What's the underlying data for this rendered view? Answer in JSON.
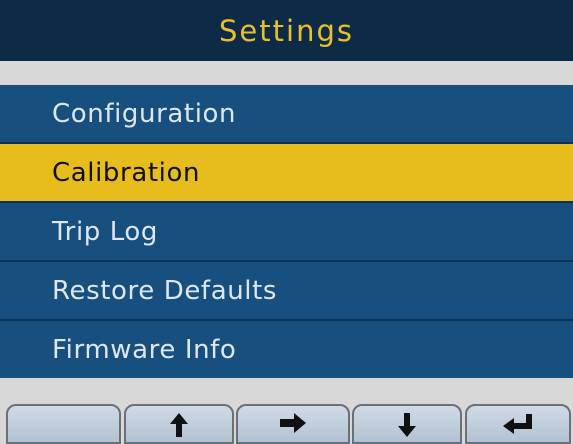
{
  "header": {
    "title": "Settings"
  },
  "menu": {
    "items": [
      {
        "label": "Configuration",
        "selected": false
      },
      {
        "label": "Calibration",
        "selected": true
      },
      {
        "label": "Trip Log",
        "selected": false
      },
      {
        "label": "Restore Defaults",
        "selected": false
      },
      {
        "label": "Firmware Info",
        "selected": false
      }
    ]
  },
  "softkeys": [
    {
      "icon": "blank"
    },
    {
      "icon": "arrow-up-icon"
    },
    {
      "icon": "arrow-right-icon"
    },
    {
      "icon": "arrow-down-icon"
    },
    {
      "icon": "arrow-return-icon"
    }
  ],
  "colors": {
    "title_bar": "#0d2a47",
    "title_text": "#e8c12a",
    "menu_bg": "#17507e",
    "selected_bg": "#e7bd1d",
    "separator": "#d8d8d8"
  }
}
